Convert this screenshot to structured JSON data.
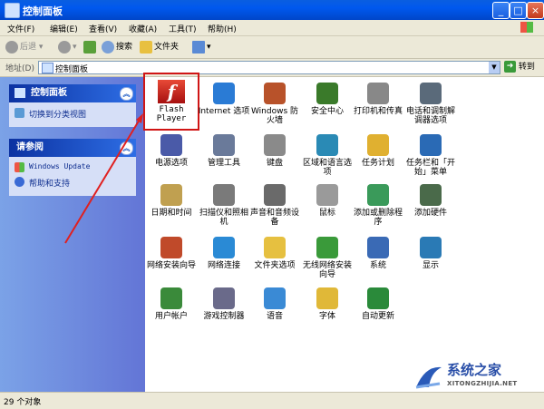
{
  "window": {
    "title": "控制面板"
  },
  "menu": [
    "文件(F)",
    "编辑(E)",
    "查看(V)",
    "收藏(A)",
    "工具(T)",
    "帮助(H)"
  ],
  "toolbar": {
    "back": "后退",
    "search": "搜索",
    "folders": "文件夹"
  },
  "address": {
    "label": "地址(D)",
    "value": "控制面板",
    "go": "转到"
  },
  "left": {
    "panel1": {
      "title": "控制面板",
      "link": "切换到分类视图"
    },
    "panel2": {
      "title": "请参阅",
      "links": [
        "Windows Update",
        "帮助和支持"
      ]
    }
  },
  "flash": {
    "line1": "Flash",
    "line2": "Player"
  },
  "items": [
    {
      "label": "Internet 选项",
      "icon": "globe-settings-icon",
      "color": "#2a7bd5"
    },
    {
      "label": "Windows 防火墙",
      "icon": "firewall-icon",
      "color": "#b8522a"
    },
    {
      "label": "安全中心",
      "icon": "shield-icon",
      "color": "#3a7a2a"
    },
    {
      "label": "打印机和传真",
      "icon": "printer-icon",
      "color": "#888888"
    },
    {
      "label": "电话和调制解调器选项",
      "icon": "phone-icon",
      "color": "#5a6a7a"
    },
    {
      "label": "电源选项",
      "icon": "power-icon",
      "color": "#4a5aa8"
    },
    {
      "label": "管理工具",
      "icon": "tools-icon",
      "color": "#6a7a9a"
    },
    {
      "label": "键盘",
      "icon": "keyboard-icon",
      "color": "#8a8a8a"
    },
    {
      "label": "区域和语言选项",
      "icon": "globe-icon",
      "color": "#2a8ab5"
    },
    {
      "label": "任务计划",
      "icon": "folder-clock-icon",
      "color": "#e0b030"
    },
    {
      "label": "任务栏和「开始」菜单",
      "icon": "taskbar-icon",
      "color": "#2a6ab5"
    },
    {
      "label": "日期和时间",
      "icon": "clock-icon",
      "color": "#c0a050"
    },
    {
      "label": "扫描仪和照相机",
      "icon": "camera-icon",
      "color": "#7a7a7a"
    },
    {
      "label": "声音和音频设备",
      "icon": "speaker-icon",
      "color": "#6a6a6a"
    },
    {
      "label": "鼠标",
      "icon": "mouse-icon",
      "color": "#9a9a9a"
    },
    {
      "label": "添加或删除程序",
      "icon": "programs-icon",
      "color": "#3a9a5a"
    },
    {
      "label": "添加硬件",
      "icon": "hardware-icon",
      "color": "#4a6a4a"
    },
    {
      "label": "网络安装向导",
      "icon": "home-network-icon",
      "color": "#c04a2a"
    },
    {
      "label": "网络连接",
      "icon": "network-globe-icon",
      "color": "#2a8ad5"
    },
    {
      "label": "文件夹选项",
      "icon": "folder-icon",
      "color": "#e6c040"
    },
    {
      "label": "无线网络安装向导",
      "icon": "wireless-icon",
      "color": "#3a9a3a"
    },
    {
      "label": "系统",
      "icon": "computer-icon",
      "color": "#3a6ab5"
    },
    {
      "label": "显示",
      "icon": "display-icon",
      "color": "#2a7ab5"
    },
    {
      "label": "用户帐户",
      "icon": "users-icon",
      "color": "#3a8a3a"
    },
    {
      "label": "游戏控制器",
      "icon": "gamepad-icon",
      "color": "#6a6a8a"
    },
    {
      "label": "语音",
      "icon": "speech-icon",
      "color": "#3a8ad5"
    },
    {
      "label": "字体",
      "icon": "fonts-folder-icon",
      "color": "#e0b838"
    },
    {
      "label": "自动更新",
      "icon": "windows-update-icon",
      "color": "#2a8a3a"
    }
  ],
  "status": "29 个对象",
  "watermark": {
    "title": "系统之家",
    "url": "XITONGZHIJIA.NET"
  }
}
